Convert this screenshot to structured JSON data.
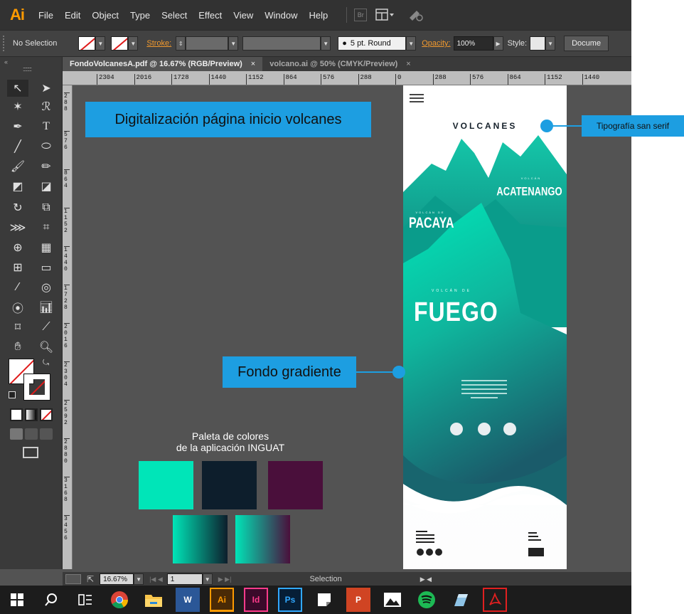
{
  "app": {
    "logo": "Ai"
  },
  "menu": [
    "File",
    "Edit",
    "Object",
    "Type",
    "Select",
    "Effect",
    "View",
    "Window",
    "Help"
  ],
  "menu_extra": {
    "bridge": "Br"
  },
  "control_bar": {
    "selection": "No Selection",
    "stroke_label": "Stroke:",
    "brush": "5 pt. Round",
    "opacity_label": "Opacity:",
    "opacity_value": "100%",
    "style_label": "Style:",
    "document_setup": "Docume"
  },
  "tabs": [
    {
      "label": "FondoVolcanesA.pdf @ 16.67% (RGB/Preview)",
      "close": "×"
    },
    {
      "label": "volcano.ai @ 50% (CMYK/Preview)",
      "close": "×"
    }
  ],
  "toolbox": {
    "collapse": "«",
    "grip": "::::::::"
  },
  "ruler": {
    "horizontal": [
      "2304",
      "2016",
      "1728",
      "1440",
      "1152",
      "864",
      "576",
      "288",
      "0",
      "288",
      "576",
      "864",
      "1152",
      "1440"
    ],
    "vertical": [
      "288",
      "576",
      "864",
      "1152",
      "1440",
      "1728",
      "2016",
      "2304",
      "2592",
      "2880",
      "3168",
      "3456"
    ]
  },
  "annotations": {
    "title": "Digitalización página inicio volcanes",
    "fondo": "Fondo gradiente",
    "tipografia": "Tipografía san serif"
  },
  "palette": {
    "title_line1": "Paleta de colores",
    "title_line2": "de la aplicación INGUAT",
    "colors": [
      "#00e5b8",
      "#0d1e2c",
      "#4a0f3b"
    ],
    "gradients": [
      [
        "#00e5b8",
        "#0d1e2c"
      ],
      [
        "#00e5b8",
        "#4a0f3b"
      ]
    ]
  },
  "artboard": {
    "brand": "VOLCANES",
    "volcano_1_small": "VOLCÁN",
    "volcano_1": "ACATENANGO",
    "volcano_2_small": "VOLCÁN DE",
    "volcano_2": "PACAYA",
    "volcano_3_small": "VOLCÁN DE",
    "volcano_3": "FUEGO"
  },
  "status_bar": {
    "zoom": "16.67%",
    "artboard_num": "1",
    "tool": "Selection"
  },
  "taskbar": {
    "word": "W",
    "illustrator": "Ai",
    "indesign": "Id",
    "photoshop": "Ps",
    "powerpoint": "P"
  }
}
